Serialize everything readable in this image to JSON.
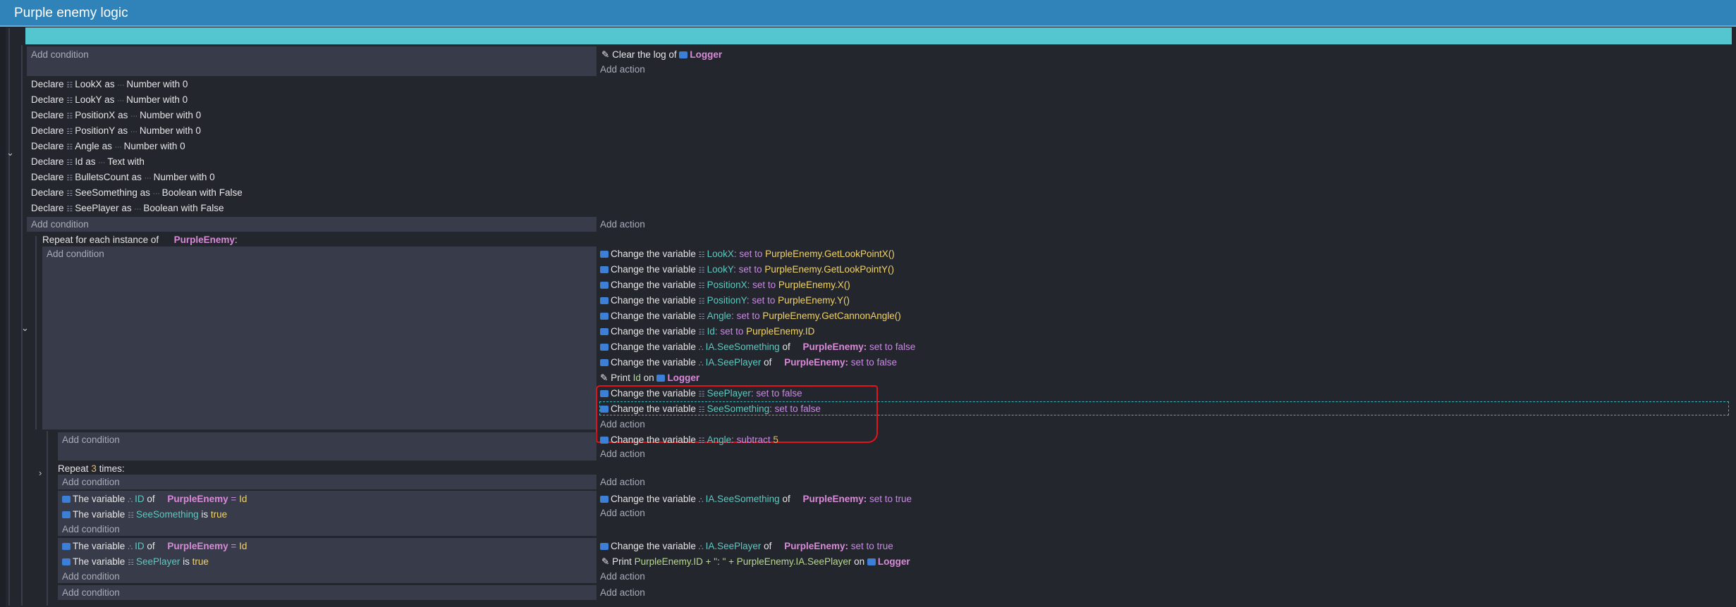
{
  "title": "Purple enemy logic",
  "add_condition": "Add condition",
  "add_action": "Add action",
  "colors": {
    "header": "#2f83b8",
    "cyan_bar": "#53c6d0",
    "highlight": "#e0141e"
  },
  "group1": {
    "action": {
      "icon": "logger-icon",
      "pre": "Clear the log of",
      "obj": "Logger"
    }
  },
  "declares": [
    {
      "w1": "Declare",
      "name": "LookX",
      "w2": "as",
      "type": "Number",
      "w3": "with",
      "value": "0"
    },
    {
      "w1": "Declare",
      "name": "LookY",
      "w2": "as",
      "type": "Number",
      "w3": "with",
      "value": "0"
    },
    {
      "w1": "Declare",
      "name": "PositionX",
      "w2": "as",
      "type": "Number",
      "w3": "with",
      "value": "0"
    },
    {
      "w1": "Declare",
      "name": "PositionY",
      "w2": "as",
      "type": "Number",
      "w3": "with",
      "value": "0"
    },
    {
      "w1": "Declare",
      "name": "Angle",
      "w2": "as",
      "type": "Number",
      "w3": "with",
      "value": "0"
    },
    {
      "w1": "Declare",
      "name": "Id",
      "w2": "as",
      "type": "Text",
      "w3": "with",
      "value": ""
    },
    {
      "w1": "Declare",
      "name": "BulletsCount",
      "w2": "as",
      "type": "Number",
      "w3": "with",
      "value": "0"
    },
    {
      "w1": "Declare",
      "name": "SeeSomething",
      "w2": "as",
      "type": "Boolean",
      "w3": "with",
      "value": "False"
    },
    {
      "w1": "Declare",
      "name": "SeePlayer",
      "w2": "as",
      "type": "Boolean",
      "w3": "with",
      "value": "False"
    }
  ],
  "foreach": {
    "pre": "Repeat for each instance of",
    "obj": "PurpleEnemy",
    "post": ":",
    "actions": [
      {
        "pre": "Change the variable",
        "var": "LookX",
        "op": ": set to",
        "val": "PurpleEnemy.GetLookPointX()"
      },
      {
        "pre": "Change the variable",
        "var": "LookY",
        "op": ": set to",
        "val": "PurpleEnemy.GetLookPointY()"
      },
      {
        "pre": "Change the variable",
        "var": "PositionX",
        "op": ": set to",
        "val": "PurpleEnemy.X()"
      },
      {
        "pre": "Change the variable",
        "var": "PositionY",
        "op": ": set to",
        "val": "PurpleEnemy.Y()"
      },
      {
        "pre": "Change the variable",
        "var": "Angle",
        "op": ": set to",
        "val": "PurpleEnemy.GetCannonAngle()"
      },
      {
        "pre": "Change the variable",
        "var": "Id",
        "op": ": set to",
        "val": "PurpleEnemy.ID"
      }
    ],
    "obj_actions": [
      {
        "pre": "Change the variable",
        "var": "IA.SeeSomething",
        "of": "of",
        "obj": "PurpleEnemy:",
        "op": "set to false"
      },
      {
        "pre": "Change the variable",
        "var": "IA.SeePlayer",
        "of": "of",
        "obj": "PurpleEnemy:",
        "op": "set to false"
      }
    ],
    "print": {
      "pre": "Print",
      "var": "Id",
      "on": "on",
      "obj": "Logger"
    },
    "hl_actions": [
      {
        "pre": "Change the variable",
        "var": "SeePlayer",
        "op": ": set to false"
      },
      {
        "pre": "Change the variable",
        "var": "SeeSomething",
        "op": ": set to false"
      }
    ]
  },
  "angle_action": {
    "pre": "Change the variable",
    "var": "Angle",
    "op": ": subtract",
    "val": "5"
  },
  "repeat": {
    "pre": "Repeat",
    "count": "3",
    "post": "times:"
  },
  "sub1": {
    "conds": [
      {
        "pre": "The variable",
        "var": "ID",
        "of": "of",
        "obj": "PurpleEnemy",
        "op": "=",
        "val": "Id"
      },
      {
        "pre": "The variable",
        "var": "SeeSomething",
        "op": "is",
        "val": "true"
      }
    ],
    "action": {
      "pre": "Change the variable",
      "var": "IA.SeeSomething",
      "of": "of",
      "obj": "PurpleEnemy:",
      "op": "set to true"
    }
  },
  "sub2": {
    "conds": [
      {
        "pre": "The variable",
        "var": "ID",
        "of": "of",
        "obj": "PurpleEnemy",
        "op": "=",
        "val": "Id"
      },
      {
        "pre": "The variable",
        "var": "SeePlayer",
        "op": "is",
        "val": "true"
      }
    ],
    "action": {
      "pre": "Change the variable",
      "var": "IA.SeePlayer",
      "of": "of",
      "obj": "PurpleEnemy:",
      "op": "set to true"
    },
    "print": {
      "pre": "Print",
      "val": "PurpleEnemy.ID + \": \" + PurpleEnemy.IA.SeePlayer",
      "on": "on",
      "obj": "Logger"
    }
  }
}
